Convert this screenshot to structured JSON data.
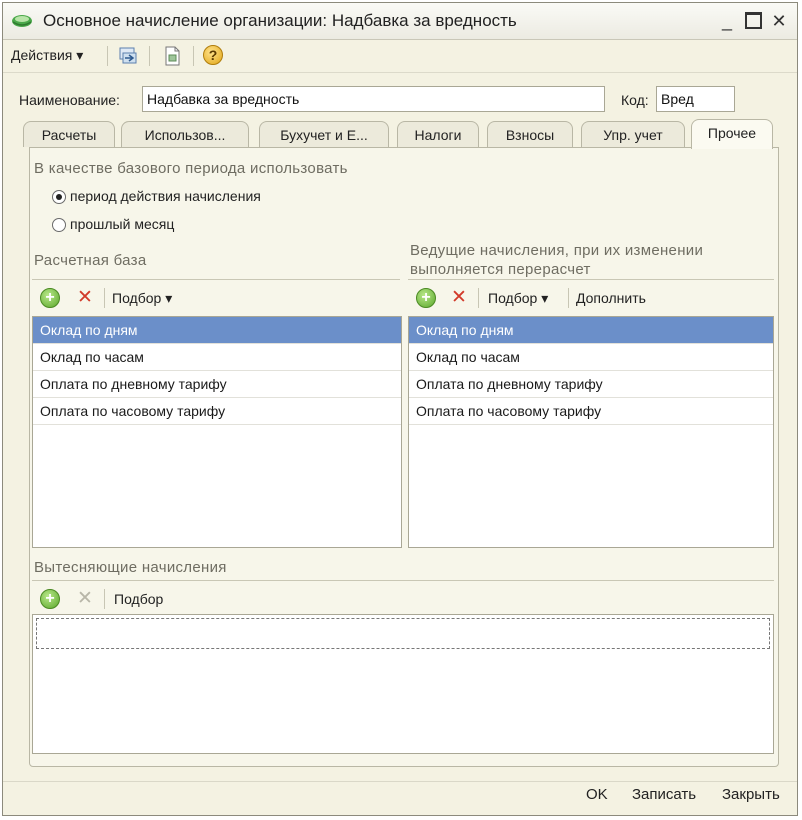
{
  "window": {
    "title": "Основное начисление организации: Надбавка за вредность",
    "controls": {
      "minimize": "_",
      "close": "✕"
    }
  },
  "toolbar": {
    "actions_label": "Действия ▾",
    "help_label": "?"
  },
  "form": {
    "name_label": "Наименование:",
    "name_value": "Надбавка за вредность",
    "code_label": "Код:",
    "code_value": "Вред"
  },
  "tabs": [
    {
      "label": "Расчеты"
    },
    {
      "label": "Использов..."
    },
    {
      "label": "Бухучет и Е..."
    },
    {
      "label": "Налоги"
    },
    {
      "label": "Взносы"
    },
    {
      "label": "Упр. учет"
    },
    {
      "label": "Прочее"
    }
  ],
  "base_period": {
    "title": "В качестве базового периода использовать",
    "options": [
      {
        "label": "период действия начисления",
        "selected": true
      },
      {
        "label": "прошлый месяц",
        "selected": false
      }
    ]
  },
  "calc_base": {
    "title": "Расчетная база",
    "pick_label": "Подбор ▾",
    "items": [
      "Оклад по дням",
      "Оклад по часам",
      "Оплата по дневному тарифу",
      "Оплата по часовому тарифу"
    ]
  },
  "leading": {
    "title_line1": "Ведущие начисления, при их изменении",
    "title_line2": "выполняется перерасчет",
    "pick_label": "Подбор ▾",
    "fill_label": "Дополнить",
    "items": [
      "Оклад по дням",
      "Оклад по часам",
      "Оплата по дневному тарифу",
      "Оплата по часовому тарифу"
    ]
  },
  "displacing": {
    "title": "Вытесняющие начисления",
    "pick_label": "Подбор"
  },
  "buttons": {
    "ok": "OK",
    "save": "Записать",
    "close": "Закрыть"
  }
}
